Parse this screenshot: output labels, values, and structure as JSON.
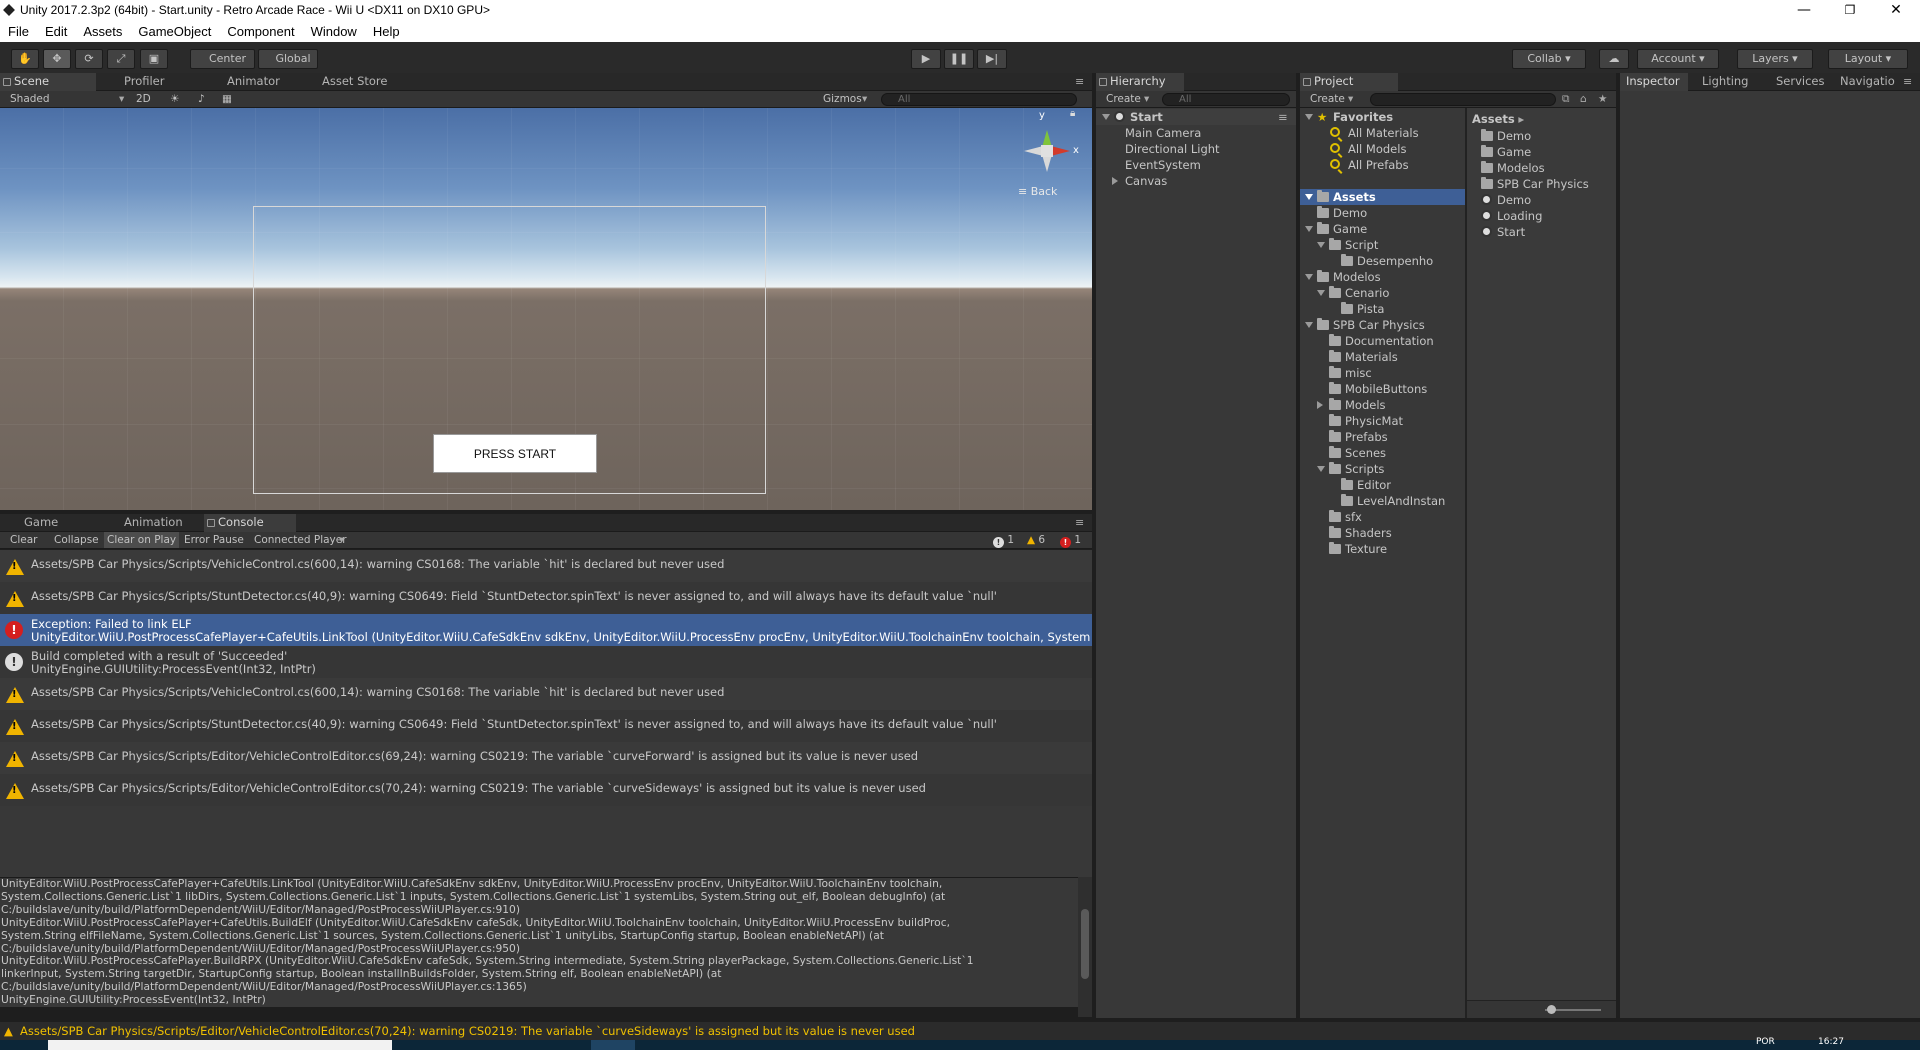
{
  "window": {
    "title": "Unity 2017.2.3p2 (64bit) - Start.unity - Retro Arcade Race - Wii U <DX11 on DX10 GPU>",
    "minimize": "—",
    "maximize": "❐",
    "close": "✕"
  },
  "menu": [
    "File",
    "Edit",
    "Assets",
    "GameObject",
    "Component",
    "Window",
    "Help"
  ],
  "toolbar": {
    "pivot": "Center",
    "space": "Global",
    "collab": "Collab ▾",
    "account": "Account",
    "layers": "Layers",
    "layout": "Layout"
  },
  "scene": {
    "tabs": [
      "Scene",
      "Profiler",
      "Animator",
      "Asset Store"
    ],
    "shading": "Shaded",
    "mode_2d": "2D",
    "gizmos": "Gizmos",
    "search_placeholder": "All",
    "back_label": "Back",
    "axis_y": "y",
    "axis_x": "x",
    "press_start": "PRESS START"
  },
  "hierarchy": {
    "tab": "Hierarchy",
    "create": "Create",
    "search_placeholder": "All",
    "scene": "Start",
    "items": [
      "Main Camera",
      "Directional Light",
      "EventSystem",
      "Canvas"
    ]
  },
  "project": {
    "tab": "Project",
    "create": "Create",
    "favorites": "Favorites",
    "fav_items": [
      "All Materials",
      "All Models",
      "All Prefabs"
    ],
    "assets": "Assets",
    "tree": [
      {
        "label": "Demo",
        "depth": 1,
        "arrow": ""
      },
      {
        "label": "Game",
        "depth": 1,
        "arrow": "down"
      },
      {
        "label": "Script",
        "depth": 2,
        "arrow": "down"
      },
      {
        "label": "Desempenho",
        "depth": 3,
        "arrow": ""
      },
      {
        "label": "Modelos",
        "depth": 1,
        "arrow": "down"
      },
      {
        "label": "Cenario",
        "depth": 2,
        "arrow": "down"
      },
      {
        "label": "Pista",
        "depth": 3,
        "arrow": ""
      },
      {
        "label": "SPB Car Physics",
        "depth": 1,
        "arrow": "down"
      },
      {
        "label": "Documentation",
        "depth": 2,
        "arrow": ""
      },
      {
        "label": "Materials",
        "depth": 2,
        "arrow": ""
      },
      {
        "label": "misc",
        "depth": 2,
        "arrow": ""
      },
      {
        "label": "MobileButtons",
        "depth": 2,
        "arrow": ""
      },
      {
        "label": "Models",
        "depth": 2,
        "arrow": "right"
      },
      {
        "label": "PhysicMat",
        "depth": 2,
        "arrow": ""
      },
      {
        "label": "Prefabs",
        "depth": 2,
        "arrow": ""
      },
      {
        "label": "Scenes",
        "depth": 2,
        "arrow": ""
      },
      {
        "label": "Scripts",
        "depth": 2,
        "arrow": "down"
      },
      {
        "label": "Editor",
        "depth": 3,
        "arrow": ""
      },
      {
        "label": "LevelAndInstan",
        "depth": 3,
        "arrow": ""
      },
      {
        "label": "sfx",
        "depth": 2,
        "arrow": ""
      },
      {
        "label": "Shaders",
        "depth": 2,
        "arrow": ""
      },
      {
        "label": "Texture",
        "depth": 2,
        "arrow": ""
      }
    ],
    "breadcrumb": "Assets",
    "contents": [
      {
        "label": "Demo",
        "type": "folder"
      },
      {
        "label": "Game",
        "type": "folder"
      },
      {
        "label": "Modelos",
        "type": "folder"
      },
      {
        "label": "SPB Car Physics",
        "type": "folder"
      },
      {
        "label": "Demo",
        "type": "scene"
      },
      {
        "label": "Loading",
        "type": "scene"
      },
      {
        "label": "Start",
        "type": "scene"
      }
    ]
  },
  "inspector": {
    "tabs": [
      "Inspector",
      "Lighting",
      "Services",
      "Navigatio"
    ]
  },
  "console": {
    "tabs": [
      "Game",
      "Animation",
      "Console"
    ],
    "buttons": [
      "Clear",
      "Collapse",
      "Clear on Play",
      "Error Pause",
      "Connected Player"
    ],
    "counts": {
      "info": "1",
      "warn": "6",
      "error": "1"
    },
    "entries": [
      {
        "type": "warn",
        "line1": "Assets/SPB Car Physics/Scripts/VehicleControl.cs(600,14): warning CS0168: The variable `hit' is declared but never used",
        "line2": ""
      },
      {
        "type": "warn",
        "line1": "Assets/SPB Car Physics/Scripts/StuntDetector.cs(40,9): warning CS0649: Field `StuntDetector.spinText' is never assigned to, and will always have its default value `null'",
        "line2": ""
      },
      {
        "type": "error",
        "line1": "Exception: Failed to link ELF",
        "line2": "UnityEditor.WiiU.PostProcessCafePlayer+CafeUtils.LinkTool (UnityEditor.WiiU.CafeSdkEnv sdkEnv, UnityEditor.WiiU.ProcessEnv procEnv, UnityEditor.WiiU.ToolchainEnv toolchain, System"
      },
      {
        "type": "info",
        "line1": "Build completed with a result of 'Succeeded'",
        "line2": "UnityEngine.GUIUtility:ProcessEvent(Int32, IntPtr)"
      },
      {
        "type": "warn",
        "line1": "Assets/SPB Car Physics/Scripts/VehicleControl.cs(600,14): warning CS0168: The variable `hit' is declared but never used",
        "line2": ""
      },
      {
        "type": "warn",
        "line1": "Assets/SPB Car Physics/Scripts/StuntDetector.cs(40,9): warning CS0649: Field `StuntDetector.spinText' is never assigned to, and will always have its default value `null'",
        "line2": ""
      },
      {
        "type": "warn",
        "line1": "Assets/SPB Car Physics/Scripts/Editor/VehicleControlEditor.cs(69,24): warning CS0219: The variable `curveForward' is assigned but its value is never used",
        "line2": ""
      },
      {
        "type": "warn",
        "line1": "Assets/SPB Car Physics/Scripts/Editor/VehicleControlEditor.cs(70,24): warning CS0219: The variable `curveSideways' is assigned but its value is never used",
        "line2": ""
      }
    ],
    "detail": [
      "UnityEditor.WiiU.PostProcessCafePlayer+CafeUtils.LinkTool (UnityEditor.WiiU.CafeSdkEnv sdkEnv, UnityEditor.WiiU.ProcessEnv procEnv, UnityEditor.WiiU.ToolchainEnv toolchain,",
      "System.Collections.Generic.List`1 libDirs, System.Collections.Generic.List`1 inputs, System.Collections.Generic.List`1 systemLibs, System.String out_elf, Boolean debugInfo) (at",
      "C:/buildslave/unity/build/PlatformDependent/WiiU/Editor/Managed/PostProcessWiiUPlayer.cs:910)",
      "UnityEditor.WiiU.PostProcessCafePlayer+CafeUtils.BuildElf (UnityEditor.WiiU.CafeSdkEnv cafeSdk, UnityEditor.WiiU.ToolchainEnv toolchain, UnityEditor.WiiU.ProcessEnv buildProc,",
      "System.String elfFileName, System.Collections.Generic.List`1 sources, System.Collections.Generic.List`1 unityLibs, StartupConfig startup, Boolean enableNetAPI) (at",
      "C:/buildslave/unity/build/PlatformDependent/WiiU/Editor/Managed/PostProcessWiiUPlayer.cs:950)",
      "UnityEditor.WiiU.PostProcessCafePlayer.BuildRPX (UnityEditor.WiiU.CafeSdkEnv cafeSdk, System.String intermediate, System.String playerPackage, System.Collections.Generic.List`1",
      "linkerInput, System.String targetDir, StartupConfig startup, Boolean installInBuildsFolder, System.String elf, Boolean enableNetAPI) (at",
      "C:/buildslave/unity/build/PlatformDependent/WiiU/Editor/Managed/PostProcessWiiUPlayer.cs:1365)",
      "UnityEngine.GUIUtility:ProcessEvent(Int32, IntPtr)"
    ]
  },
  "status": "Assets/SPB Car Physics/Scripts/Editor/VehicleControlEditor.cs(70,24): warning CS0219: The variable `curveSideways' is assigned but its value is never used",
  "taskbar": {
    "lang": "POR",
    "time": "16:27"
  }
}
